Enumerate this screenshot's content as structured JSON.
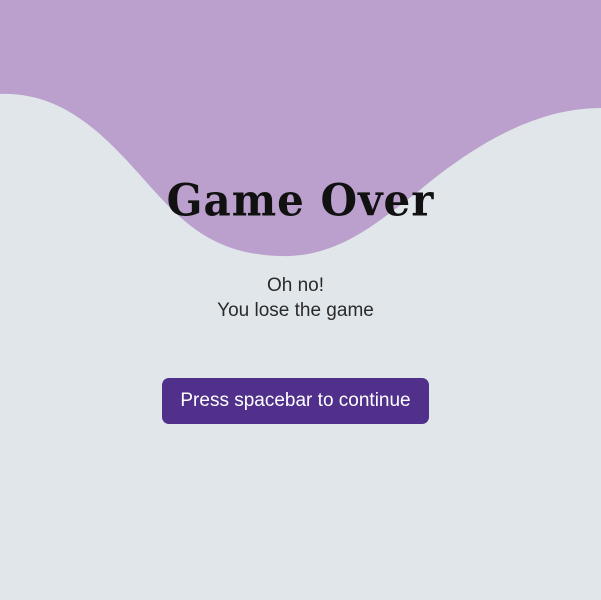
{
  "game_over": {
    "title": "Game Over",
    "line1": "Oh no!",
    "line2": "You lose the game",
    "continue_label": "Press spacebar to continue"
  },
  "colors": {
    "top_wave": "#bb9fcc",
    "background": "#e0e6ea",
    "button": "#51308c",
    "button_text": "#ffffff",
    "title_text": "#111111"
  }
}
